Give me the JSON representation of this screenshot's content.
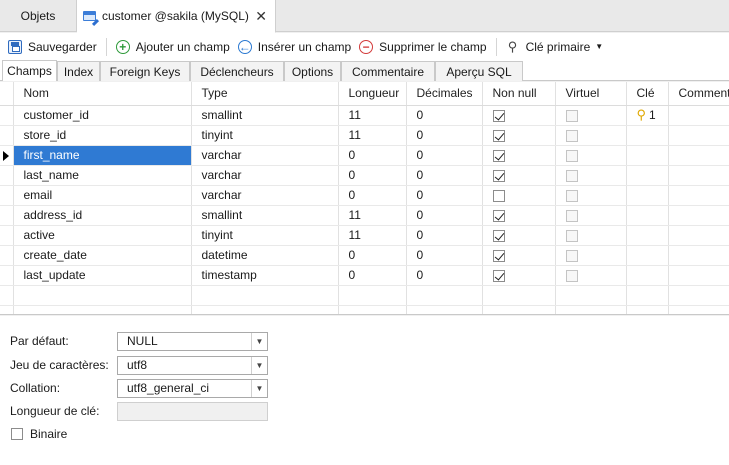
{
  "doc_tabs": {
    "objets": "Objets",
    "active_title": "customer @sakila (MySQL)",
    "close_glyph": "✕"
  },
  "toolbar": {
    "save": "Sauvegarder",
    "add_field": "Ajouter un champ",
    "insert_field": "Insérer un champ",
    "delete_field": "Supprimer le champ",
    "primary_key": "Clé primaire"
  },
  "subtabs": [
    "Champs",
    "Index",
    "Foreign Keys",
    "Déclencheurs",
    "Options",
    "Commentaire",
    "Aperçu SQL"
  ],
  "grid": {
    "columns": [
      "Nom",
      "Type",
      "Longueur",
      "Décimales",
      "Non null",
      "Virtuel",
      "Clé",
      "Commentaire"
    ],
    "rows": [
      {
        "name": "customer_id",
        "type": "smallint",
        "length": "11",
        "decimals": "0",
        "not_null": true,
        "key": "1"
      },
      {
        "name": "store_id",
        "type": "tinyint",
        "length": "11",
        "decimals": "0",
        "not_null": true,
        "key": ""
      },
      {
        "name": "first_name",
        "type": "varchar",
        "length": "0",
        "decimals": "0",
        "not_null": true,
        "key": ""
      },
      {
        "name": "last_name",
        "type": "varchar",
        "length": "0",
        "decimals": "0",
        "not_null": true,
        "key": ""
      },
      {
        "name": "email",
        "type": "varchar",
        "length": "0",
        "decimals": "0",
        "not_null": false,
        "key": ""
      },
      {
        "name": "address_id",
        "type": "smallint",
        "length": "11",
        "decimals": "0",
        "not_null": true,
        "key": ""
      },
      {
        "name": "active",
        "type": "tinyint",
        "length": "11",
        "decimals": "0",
        "not_null": true,
        "key": ""
      },
      {
        "name": "create_date",
        "type": "datetime",
        "length": "0",
        "decimals": "0",
        "not_null": true,
        "key": ""
      },
      {
        "name": "last_update",
        "type": "timestamp",
        "length": "0",
        "decimals": "0",
        "not_null": true,
        "key": ""
      }
    ],
    "selected_row": 2
  },
  "properties": {
    "default_label": "Par défaut:",
    "default_value": "NULL",
    "charset_label": "Jeu de caractères:",
    "charset_value": "utf8",
    "collation_label": "Collation:",
    "collation_value": "utf8_general_ci",
    "key_length_label": "Longueur de clé:",
    "key_length_value": "",
    "binary_label": "Binaire",
    "binary_checked": false
  },
  "colors": {
    "selection": "#2f7ad3",
    "key_icon": "#e0a800",
    "add_icon": "#2e9a3a",
    "insert_icon": "#2b79d1",
    "remove_icon": "#d33b3b"
  }
}
